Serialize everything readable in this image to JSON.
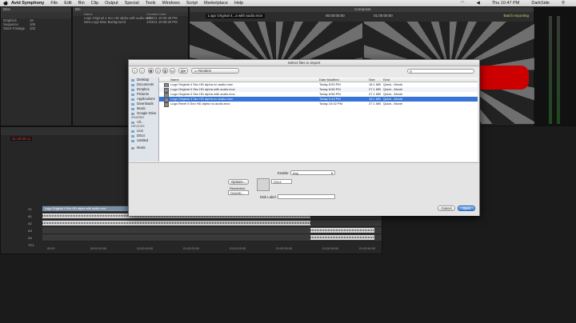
{
  "menubar": {
    "app": "Avid Symphony",
    "items": [
      "File",
      "Edit",
      "Bin",
      "Clip",
      "Output",
      "Special",
      "Tools",
      "Windows",
      "Script",
      "Marketplace",
      "Help"
    ],
    "clock": "Thu 10:47 PM",
    "user": "DarkSide"
  },
  "bin": {
    "title": "Bins",
    "rows": [
      {
        "name": "Graphics",
        "count": "18"
      },
      {
        "name": "Sequence",
        "count": "106"
      },
      {
        "name": "Stock Footage",
        "count": "103"
      }
    ]
  },
  "clips": {
    "title": "Bin",
    "columns": [
      "Name",
      "Creation Date"
    ],
    "rows": [
      {
        "name": "Logo Original 4 Sec HD alpha with audio.mov",
        "date": "1/03/11  10:00:49 PM"
      },
      {
        "name": "New Logo Blue Background",
        "date": "1/03/11  10:06:25 PM"
      }
    ]
  },
  "composer": {
    "title": "Composer",
    "source_name": "Logo Original 4...a with audio.mov",
    "tc_left": "00:00:00:00",
    "tc_right": "01:00:00:00",
    "status": "Batch Importing"
  },
  "dialog": {
    "title": "Select files to import",
    "path": "Renders",
    "search_placeholder": "",
    "sidebar": {
      "sections": [
        {
          "header": "",
          "items": [
            "Desktop",
            "Documents",
            "Dropbox",
            "Pictures",
            "Applications",
            "Downloads",
            "Music",
            "Google Drive"
          ]
        },
        {
          "header": "SHARED",
          "items": [
            "All..."
          ]
        },
        {
          "header": "DEVICES",
          "items": [
            "Lion",
            "D014",
            "Untitled"
          ]
        },
        {
          "header": "",
          "items": [
            "Music"
          ]
        }
      ]
    },
    "columns": {
      "name": "Name",
      "date": "Date Modified",
      "size": "Size",
      "kind": "Kind"
    },
    "files": [
      {
        "name": "Logo Original 4 Sec HD alpha no audio.mov",
        "date": "Today 8:53 PM",
        "size": "18.1 MB",
        "kind": "Quick...Movie",
        "selected": false
      },
      {
        "name": "Logo Original 4 Sec HD alpha with audio.mov",
        "date": "Today 8:56 PM",
        "size": "27.1 MB",
        "kind": "Quick...Movie",
        "selected": false
      },
      {
        "name": "Logo Original 4 Sec HD alpha with audio.mov",
        "date": "Today 8:56 PM",
        "size": "27.1 MB",
        "kind": "Quick...Movie",
        "selected": false
      },
      {
        "name": "Logo Original 4 Sec HD alpha no audio.mov",
        "date": "Today 9:43 PM",
        "size": "18.1 MB",
        "kind": "Quick...Movie",
        "selected": true
      },
      {
        "name": "Logo Revel 5 Sec HD alpha no audio.mov",
        "date": "Today 10:02 PM",
        "size": "27.1 MB",
        "kind": "Quick...Movie",
        "selected": false
      }
    ],
    "enable_label": "Enable:",
    "enable_value": "Any",
    "options_button": "Options...",
    "resolution_label": "Resolution:",
    "resolution_value": "DNxHD...",
    "drive_value": "D014",
    "disk_label": "Disk Label:",
    "cancel": "Cancel",
    "open": "Open"
  },
  "timeline": {
    "timecode": "01:00:00:11",
    "tracks": [
      "V1",
      "A1",
      "A2",
      "A3",
      "A4",
      "TC1"
    ],
    "ruler": [
      "00:00",
      "00:00:10:00",
      "01:00:15:00",
      "01:00:20:00",
      "01:00:25:00",
      "01:00:30:00",
      "01:00:35:00",
      "01:00:40:00"
    ],
    "clip_label": "Logo Original 4 Sec HD alpha with audio.mov"
  }
}
